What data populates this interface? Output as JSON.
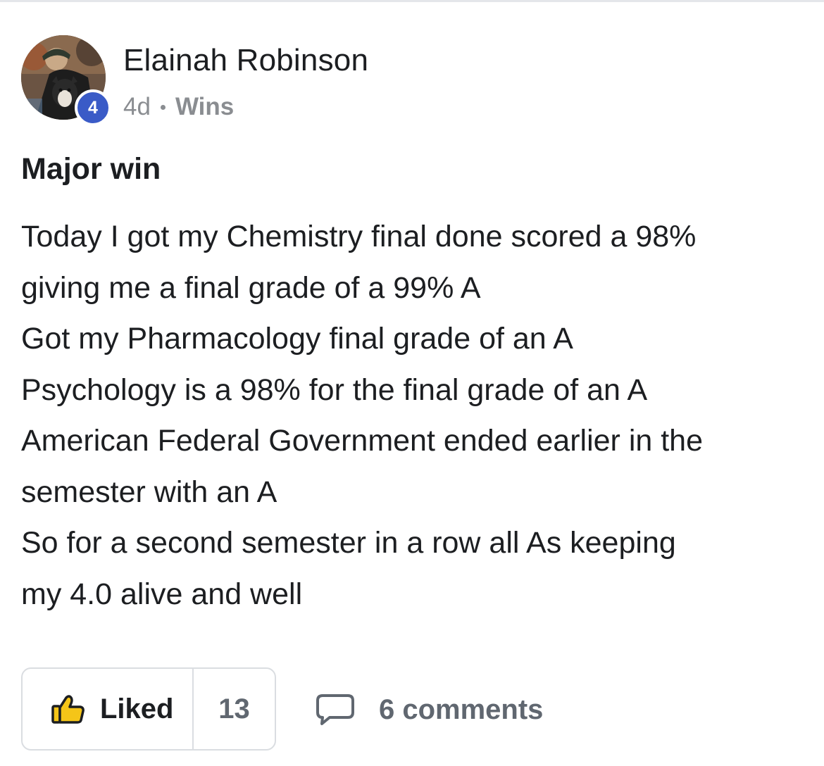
{
  "author": {
    "name": "Elainah Robinson",
    "level": "4",
    "avatar_icon": "user-photo-avatar"
  },
  "meta": {
    "time": "4d",
    "separator": "•",
    "category": "Wins"
  },
  "post": {
    "title": "Major win",
    "lines": [
      "Today I got my Chemistry final done scored a 98%",
      "giving me a final grade of a 99% A",
      "Got my Pharmacology final grade of an A",
      "Psychology is a 98% for the final grade of an A",
      "American Federal Government ended earlier in the",
      "semester with an A",
      "So for a second semester in a row all As keeping",
      "my 4.0 alive and well"
    ]
  },
  "actions": {
    "like_label": "Liked",
    "like_count": "13",
    "like_icon": "thumbs-up-icon",
    "like_icon_color": "#f5c518",
    "comments_label": "6 comments",
    "comment_icon": "comment-bubble-icon"
  },
  "colors": {
    "badge": "#3a5bc7",
    "text_primary": "#1c1e21",
    "text_secondary": "#8a8d91"
  }
}
